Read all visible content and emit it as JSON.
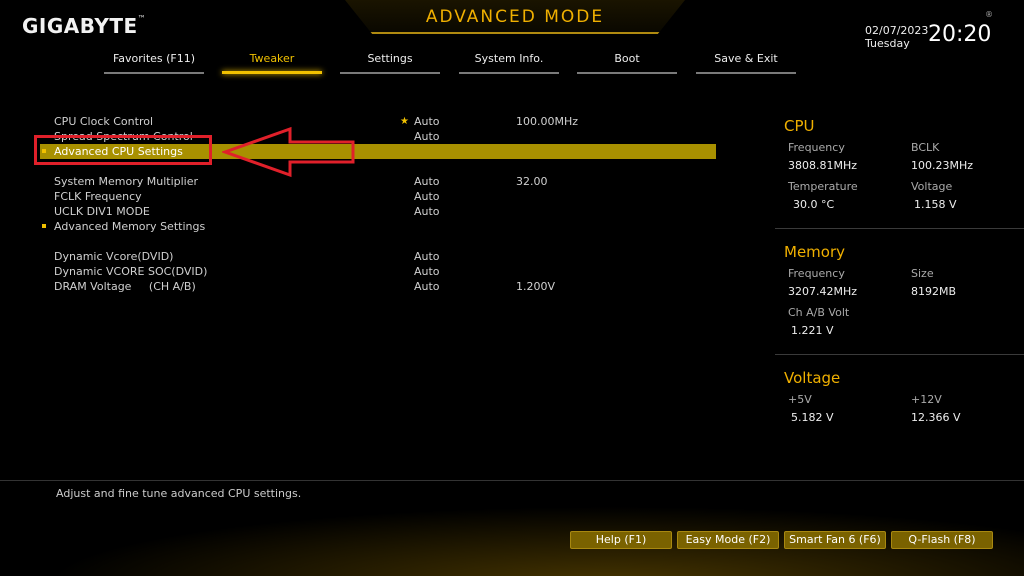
{
  "header": {
    "logo": "GIGABYTE",
    "logo_mark": "™",
    "mode_title": "ADVANCED MODE",
    "date": "02/07/2023",
    "day": "Tuesday",
    "time": "20:20",
    "reg": "®"
  },
  "tabs": [
    {
      "label": "Favorites (F11)"
    },
    {
      "label": "Tweaker"
    },
    {
      "label": "Settings"
    },
    {
      "label": "System Info."
    },
    {
      "label": "Boot"
    },
    {
      "label": "Save & Exit"
    }
  ],
  "settings": {
    "cpu_clock": {
      "name": "CPU Clock Control",
      "value": "Auto",
      "value2": "100.00MHz"
    },
    "spread_spectrum": {
      "name": "Spread Spectrum Control",
      "value": "Auto"
    },
    "adv_cpu": {
      "name": "Advanced CPU Settings"
    },
    "mem_mult": {
      "name": "System Memory Multiplier",
      "value": "Auto",
      "value2": "32.00"
    },
    "fclk": {
      "name": "FCLK Frequency",
      "value": "Auto"
    },
    "uclk": {
      "name": "UCLK DIV1 MODE",
      "value": "Auto"
    },
    "adv_mem": {
      "name": "Advanced Memory Settings"
    },
    "vcore": {
      "name": "Dynamic Vcore(DVID)",
      "value": "Auto"
    },
    "vcore_soc": {
      "name": "Dynamic VCORE SOC(DVID)",
      "value": "Auto"
    },
    "dram_v": {
      "name": "DRAM Voltage     (CH A/B)",
      "value": "Auto",
      "value2": "1.200V"
    }
  },
  "panel": {
    "cpu": {
      "title": "CPU",
      "freq_label": "Frequency",
      "freq": "3808.81MHz",
      "bclk_label": "BCLK",
      "bclk": "100.23MHz",
      "temp_label": "Temperature",
      "temp": "30.0 °C",
      "volt_label": "Voltage",
      "volt": "1.158 V"
    },
    "memory": {
      "title": "Memory",
      "freq_label": "Frequency",
      "freq": "3207.42MHz",
      "size_label": "Size",
      "size": "8192MB",
      "volt_label": "Ch A/B Volt",
      "volt": "1.221 V"
    },
    "voltage": {
      "title": "Voltage",
      "v5_label": "+5V",
      "v5": "5.182 V",
      "v12_label": "+12V",
      "v12": "12.366 V"
    }
  },
  "help_text": "Adjust and fine tune advanced CPU settings.",
  "footer_buttons": {
    "help": "Help (F1)",
    "easy": "Easy Mode (F2)",
    "fan": "Smart Fan 6 (F6)",
    "qflash": "Q-Flash (F8)"
  },
  "colors": {
    "accent": "#f0b000",
    "highlight": "#a89000",
    "annotation": "#e0202a"
  }
}
